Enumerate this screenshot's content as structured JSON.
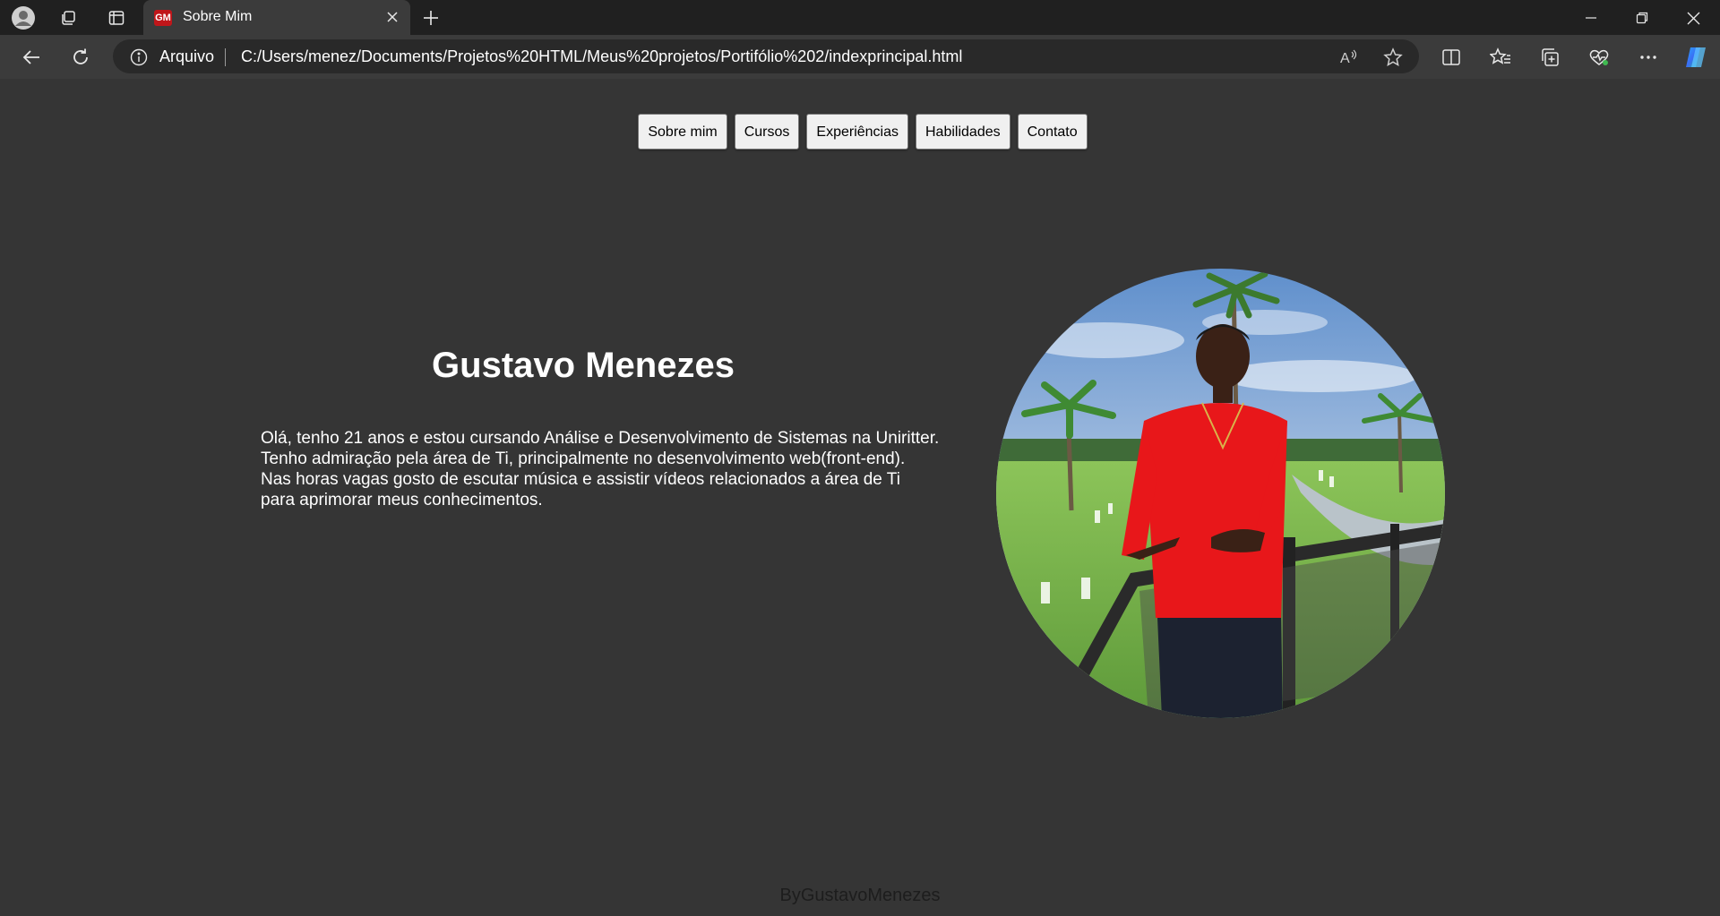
{
  "browser": {
    "tab_title": "Sobre Mim",
    "favicon_text": "GM",
    "address_info_label": "Arquivo",
    "url": "C:/Users/menez/Documents/Projetos%20HTML/Meus%20projetos/Portifólio%202/indexprincipal.html",
    "read_aloud_text": "A"
  },
  "nav": {
    "items": [
      {
        "label": "Sobre mim"
      },
      {
        "label": "Cursos"
      },
      {
        "label": "Experiências"
      },
      {
        "label": "Habilidades"
      },
      {
        "label": "Contato"
      }
    ]
  },
  "profile": {
    "name": "Gustavo Menezes",
    "bio_lines": [
      "Olá, tenho 21 anos e estou cursando Análise e Desenvolvimento de Sistemas na Uniritter.",
      "Tenho admiração pela área de Ti, principalmente no desenvolvimento web(front-end).",
      "Nas horas vagas gosto de escutar música e assistir vídeos relacionados a área de Ti",
      "para aprimorar meus conhecimentos."
    ]
  },
  "footer": {
    "text": "ByGustavoMenezes"
  },
  "colors": {
    "page_background": "#353535",
    "tab_strip": "#202020",
    "toolbar": "#3b3b3b",
    "shirt_red": "#e8171a",
    "sky_blue": "#7fa8d6",
    "grass_green": "#7db84a"
  },
  "icons": [
    "profile-icon",
    "workspaces-icon",
    "tab-actions-icon",
    "close-icon",
    "new-tab-icon",
    "minimize-icon",
    "restore-icon",
    "window-close-icon",
    "back-icon",
    "refresh-icon",
    "info-icon",
    "read-aloud-icon",
    "favorite-star-icon",
    "split-screen-icon",
    "favorites-icon",
    "collections-icon",
    "browser-essentials-icon",
    "more-icon",
    "copilot-icon"
  ]
}
